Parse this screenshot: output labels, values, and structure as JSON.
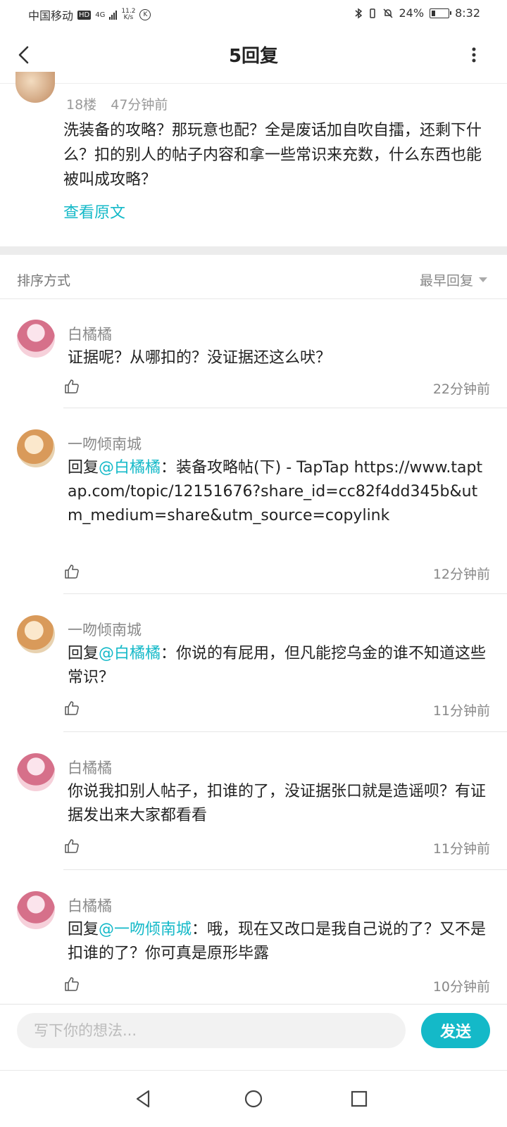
{
  "status": {
    "carrier": "中国移动",
    "hd": "HD",
    "network": "4G",
    "speed_top": "11.2",
    "speed_bottom": "K/s",
    "k_badge": "K",
    "battery": "24%",
    "battery_level": 0.24,
    "time": "8:32"
  },
  "header": {
    "title": "5回复"
  },
  "origin_post": {
    "floor": "18楼",
    "time": "47分钟前",
    "content": "洗装备的攻略？那玩意也配？全是废话加自吹自擂，还剩下什么？扣的别人的帖子内容和拿一些常识来充数，什么东西也能被叫成攻略？",
    "view_original": "查看原文"
  },
  "sort": {
    "label": "排序方式",
    "value": "最早回复"
  },
  "replies": [
    {
      "user": "白橘橘",
      "prefix": "",
      "mention": "",
      "separator": "",
      "text": "证据呢？从哪扣的？没证据还这么吠？",
      "time": "22分钟前"
    },
    {
      "user": "一吻倾南城",
      "prefix": "回复",
      "mention": "@白橘橘",
      "separator": "：",
      "text": "装备攻略帖(下) - TapTap https://www.taptap.com/topic/12151676?share_id=cc82f4dd345b&utm_medium=share&utm_source=copylink",
      "time": "12分钟前"
    },
    {
      "user": "一吻倾南城",
      "prefix": "回复",
      "mention": "@白橘橘",
      "separator": "：",
      "text": "你说的有屁用，但凡能挖乌金的谁不知道这些常识？",
      "time": "11分钟前"
    },
    {
      "user": "白橘橘",
      "prefix": "",
      "mention": "",
      "separator": "",
      "text": "你说我扣别人帖子，扣谁的了，没证据张口就是造谣呗？有证据发出来大家都看看",
      "time": "11分钟前"
    },
    {
      "user": "白橘橘",
      "prefix": "回复",
      "mention": "@一吻倾南城",
      "separator": "：",
      "text": "哦，现在又改口是我自己说的了？又不是扣谁的了？你可真是原形毕露",
      "time": "10分钟前"
    }
  ],
  "input": {
    "placeholder": "写下你的想法...",
    "send_label": "发送"
  },
  "colors": {
    "accent": "#14b9c8",
    "meta_gray": "#888888"
  },
  "icons": {
    "back": "chevron-left-icon",
    "more": "more-vertical-icon",
    "like": "thumb-up-icon",
    "nav_back": "triangle-back-icon",
    "nav_home": "circle-home-icon",
    "nav_recent": "square-recent-icon"
  }
}
